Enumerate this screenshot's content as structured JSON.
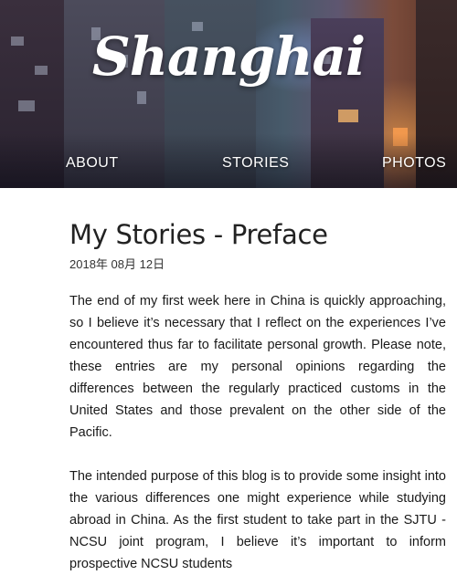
{
  "header": {
    "logo_text": "Shanghai",
    "nav": {
      "about": "ABOUT",
      "stories": "STORIES",
      "photos": "PHOTOS"
    }
  },
  "post": {
    "title": "My Stories - Preface",
    "date": "2018年 08月 12日",
    "paragraphs": [
      "The end of my first week here in China is quickly approaching, so I believe it’s necessary that I reflect on the experiences I’ve encountered thus far to facilitate personal growth. Please note, these entries are my personal opinions regarding the differences between the regularly practiced customs in the United States and those prevalent on the other side of the Pacific.",
      "The intended purpose of this blog is to provide some insight into the various differences one might experience while studying abroad in China. As the first student to take part in the SJTU - NCSU joint program, I believe it’s important to inform prospective NCSU students"
    ]
  },
  "colors": {
    "text": "#1a1a1a",
    "title": "#222222",
    "nav_text": "#ffffff"
  }
}
